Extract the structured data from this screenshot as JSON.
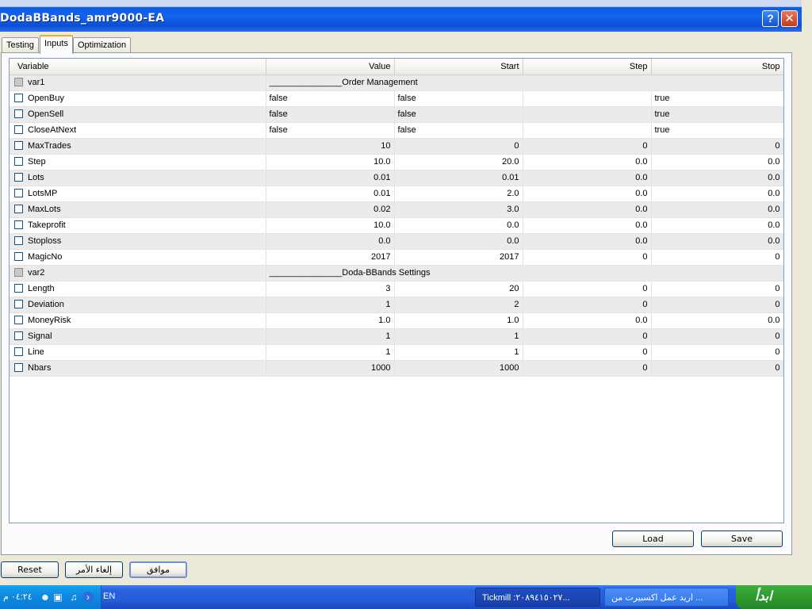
{
  "window": {
    "title": "DodaBBands_amr9000-EA",
    "help_label": "?",
    "close_label": "✕"
  },
  "tabs": [
    {
      "label": "Testing"
    },
    {
      "label": "Inputs"
    },
    {
      "label": "Optimization"
    }
  ],
  "grid": {
    "headers": {
      "variable": "Variable",
      "value": "Value",
      "start": "Start",
      "step": "Step",
      "stop": "Stop"
    },
    "rows": [
      {
        "variable": "var1",
        "value": "_______________Order Management",
        "start": "",
        "step": "",
        "stop": "",
        "group": true
      },
      {
        "variable": "OpenBuy",
        "value": "false",
        "start": "false",
        "step": "",
        "stop": "true",
        "text": true
      },
      {
        "variable": "OpenSell",
        "value": "false",
        "start": "false",
        "step": "",
        "stop": "true",
        "text": true
      },
      {
        "variable": "CloseAtNext",
        "value": "false",
        "start": "false",
        "step": "",
        "stop": "true",
        "text": true
      },
      {
        "variable": "MaxTrades",
        "value": "10",
        "start": "0",
        "step": "0",
        "stop": "0"
      },
      {
        "variable": "Step",
        "value": "10.0",
        "start": "20.0",
        "step": "0.0",
        "stop": "0.0"
      },
      {
        "variable": "Lots",
        "value": "0.01",
        "start": "0.01",
        "step": "0.0",
        "stop": "0.0"
      },
      {
        "variable": "LotsMP",
        "value": "0.01",
        "start": "2.0",
        "step": "0.0",
        "stop": "0.0"
      },
      {
        "variable": "MaxLots",
        "value": "0.02",
        "start": "3.0",
        "step": "0.0",
        "stop": "0.0"
      },
      {
        "variable": "Takeprofit",
        "value": "10.0",
        "start": "0.0",
        "step": "0.0",
        "stop": "0.0"
      },
      {
        "variable": "Stoploss",
        "value": "0.0",
        "start": "0.0",
        "step": "0.0",
        "stop": "0.0"
      },
      {
        "variable": "MagicNo",
        "value": "2017",
        "start": "2017",
        "step": "0",
        "stop": "0"
      },
      {
        "variable": "var2",
        "value": "_______________Doda-BBands Settings",
        "start": "",
        "step": "",
        "stop": "",
        "group": true
      },
      {
        "variable": "Length",
        "value": "3",
        "start": "20",
        "step": "0",
        "stop": "0"
      },
      {
        "variable": "Deviation",
        "value": "1",
        "start": "2",
        "step": "0",
        "stop": "0"
      },
      {
        "variable": "MoneyRisk",
        "value": "1.0",
        "start": "1.0",
        "step": "0.0",
        "stop": "0.0"
      },
      {
        "variable": "Signal",
        "value": "1",
        "start": "1",
        "step": "0",
        "stop": "0"
      },
      {
        "variable": "Line",
        "value": "1",
        "start": "1",
        "step": "0",
        "stop": "0"
      },
      {
        "variable": "Nbars",
        "value": "1000",
        "start": "1000",
        "step": "0",
        "stop": "0"
      }
    ]
  },
  "panel_buttons": {
    "load": "Load",
    "save": "Save"
  },
  "dialog_buttons": {
    "reset": "Reset",
    "cancel": "إلغاء الأمر",
    "ok": "موافق"
  },
  "taskbar": {
    "clock": "٠٤:٢٤ م",
    "language": "EN",
    "task1": "Tickmill :٢٠٨٩٤١٥٠٢٧...",
    "task2": "اريد عمل اكسبيرت من ...",
    "start_label": "ابدأ"
  }
}
